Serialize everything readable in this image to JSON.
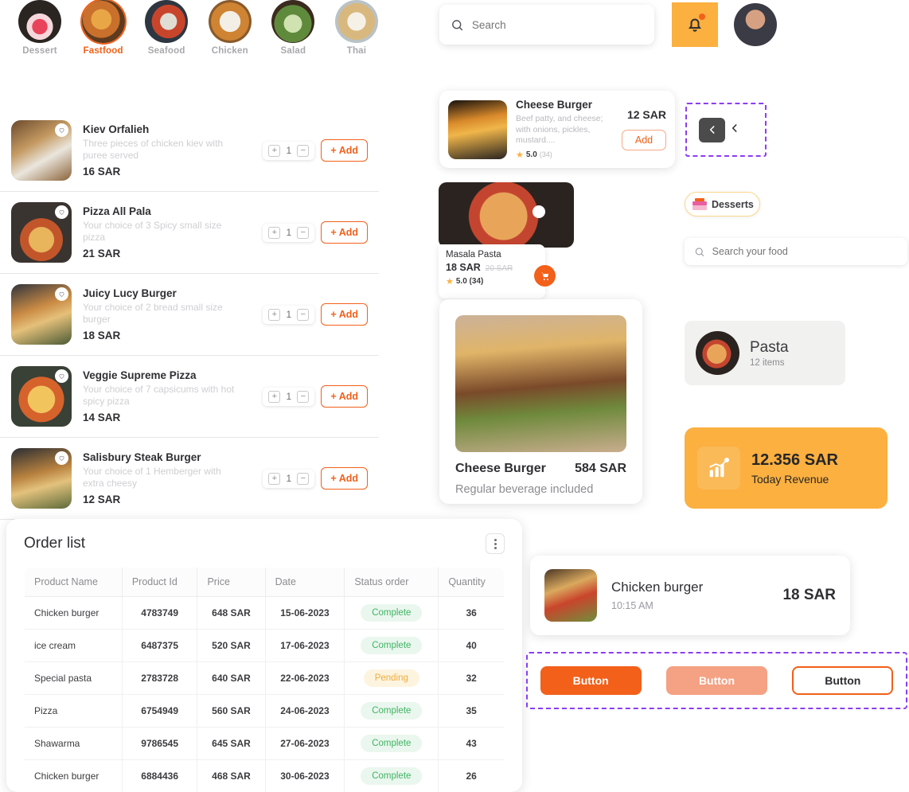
{
  "categories": [
    {
      "label": "Dessert",
      "icon": "dessert-thumb",
      "active": false
    },
    {
      "label": "Fastfood",
      "icon": "fastfood-thumb",
      "active": true
    },
    {
      "label": "Seafood",
      "icon": "seafood-thumb",
      "active": false
    },
    {
      "label": "Chicken",
      "icon": "chicken-thumb",
      "active": false
    },
    {
      "label": "Salad",
      "icon": "salad-thumb",
      "active": false
    },
    {
      "label": "Thai",
      "icon": "thai-thumb",
      "active": false
    }
  ],
  "food_list": [
    {
      "name": "Kiev Orfalieh",
      "desc": "Three pieces of chicken kiev with puree served",
      "price": "16 SAR",
      "qty": "1",
      "add_label": "+ Add",
      "img": "ph-kiev"
    },
    {
      "name": "Pizza All Pala",
      "desc": "Your choice of  3 Spicy small size pizza",
      "price": "21 SAR",
      "qty": "1",
      "add_label": "+ Add",
      "img": "ph-pizza1"
    },
    {
      "name": "Juicy Lucy Burger",
      "desc": "Your choice of  2 bread small size burger",
      "price": "18 SAR",
      "qty": "1",
      "add_label": "+ Add",
      "img": "ph-burger1"
    },
    {
      "name": "Veggie Supreme Pizza",
      "desc": "Your choice of  7 capsicums with hot spicy pizza",
      "price": "14 SAR",
      "qty": "1",
      "add_label": "+ Add",
      "img": "ph-pizza2"
    },
    {
      "name": "Salisbury Steak Burger",
      "desc": "Your choice of  1 Hemberger with extra cheesy",
      "price": "12 SAR",
      "qty": "1",
      "add_label": "+ Add",
      "img": "ph-burger2"
    }
  ],
  "order_panel": {
    "title": "Order list",
    "columns": [
      "Product Name",
      "Product Id",
      "Price",
      "Date",
      "Status order",
      "Quantity"
    ],
    "rows": [
      {
        "name": "Chicken burger",
        "id": "4783749",
        "price": "648 SAR",
        "date": "15-06-2023",
        "status": "Complete",
        "status_kind": "complete",
        "qty": "36"
      },
      {
        "name": "ice cream",
        "id": "6487375",
        "price": "520 SAR",
        "date": "17-06-2023",
        "status": "Complete",
        "status_kind": "complete",
        "qty": "40"
      },
      {
        "name": "Special pasta",
        "id": "2783728",
        "price": "640 SAR",
        "date": "22-06-2023",
        "status": "Pending",
        "status_kind": "pending",
        "qty": "32"
      },
      {
        "name": "Pizza",
        "id": "6754949",
        "price": "560 SAR",
        "date": "24-06-2023",
        "status": "Complete",
        "status_kind": "complete",
        "qty": "35"
      },
      {
        "name": "Shawarma",
        "id": "9786545",
        "price": "645 SAR",
        "date": "27-06-2023",
        "status": "Complete",
        "status_kind": "complete",
        "qty": "43"
      },
      {
        "name": "Chicken burger",
        "id": "6884436",
        "price": "468 SAR",
        "date": "30-06-2023",
        "status": "Complete",
        "status_kind": "complete",
        "qty": "26"
      }
    ]
  },
  "topbar": {
    "search_placeholder": "Search",
    "search_value": "",
    "notification_icon": "bell-icon",
    "has_notification_dot": true,
    "avatar": "user-avatar"
  },
  "cheese_burger_card": {
    "name": "Cheese Burger",
    "desc": "Beef patty, and cheese; with onions, pickles, mustard....",
    "rating": "5.0",
    "rating_count": "(34)",
    "price": "12 SAR",
    "add_label": "Add"
  },
  "masala_pasta_card": {
    "name": "Masala Pasta",
    "price": "18 SAR",
    "old_price": "20 SAR",
    "rating": "5.0 (34)",
    "cart_icon": "cart-icon"
  },
  "big_card": {
    "name": "Cheese Burger",
    "price": "584 SAR",
    "subtitle": "Regular beverage included"
  },
  "nav_selection": {
    "back_button_icon": "chevron-left-icon",
    "back_chevron_icon": "chevron-left-icon"
  },
  "desserts_chip": {
    "label": "Desserts",
    "icon": "cake-icon"
  },
  "food_search": {
    "placeholder": "Search your food",
    "value": "",
    "icon": "search-icon"
  },
  "pasta_card": {
    "name": "Pasta",
    "items": "12 items"
  },
  "revenue_card": {
    "value": "12.356 SAR",
    "label": "Today Revenue",
    "icon": "bar-chart-icon",
    "color": "#fbb040"
  },
  "order_item": {
    "name": "Chicken burger",
    "time": "10:15 AM",
    "price": "18 SAR"
  },
  "buttons_selection": {
    "primary_label": "Button",
    "secondary_label": "Button",
    "outline_label": "Button"
  },
  "theme": {
    "accent": "#f2601a",
    "amber": "#fbb040",
    "complete": "#3fb463",
    "pending": "#efad3c",
    "selection": "#8b3df5"
  }
}
